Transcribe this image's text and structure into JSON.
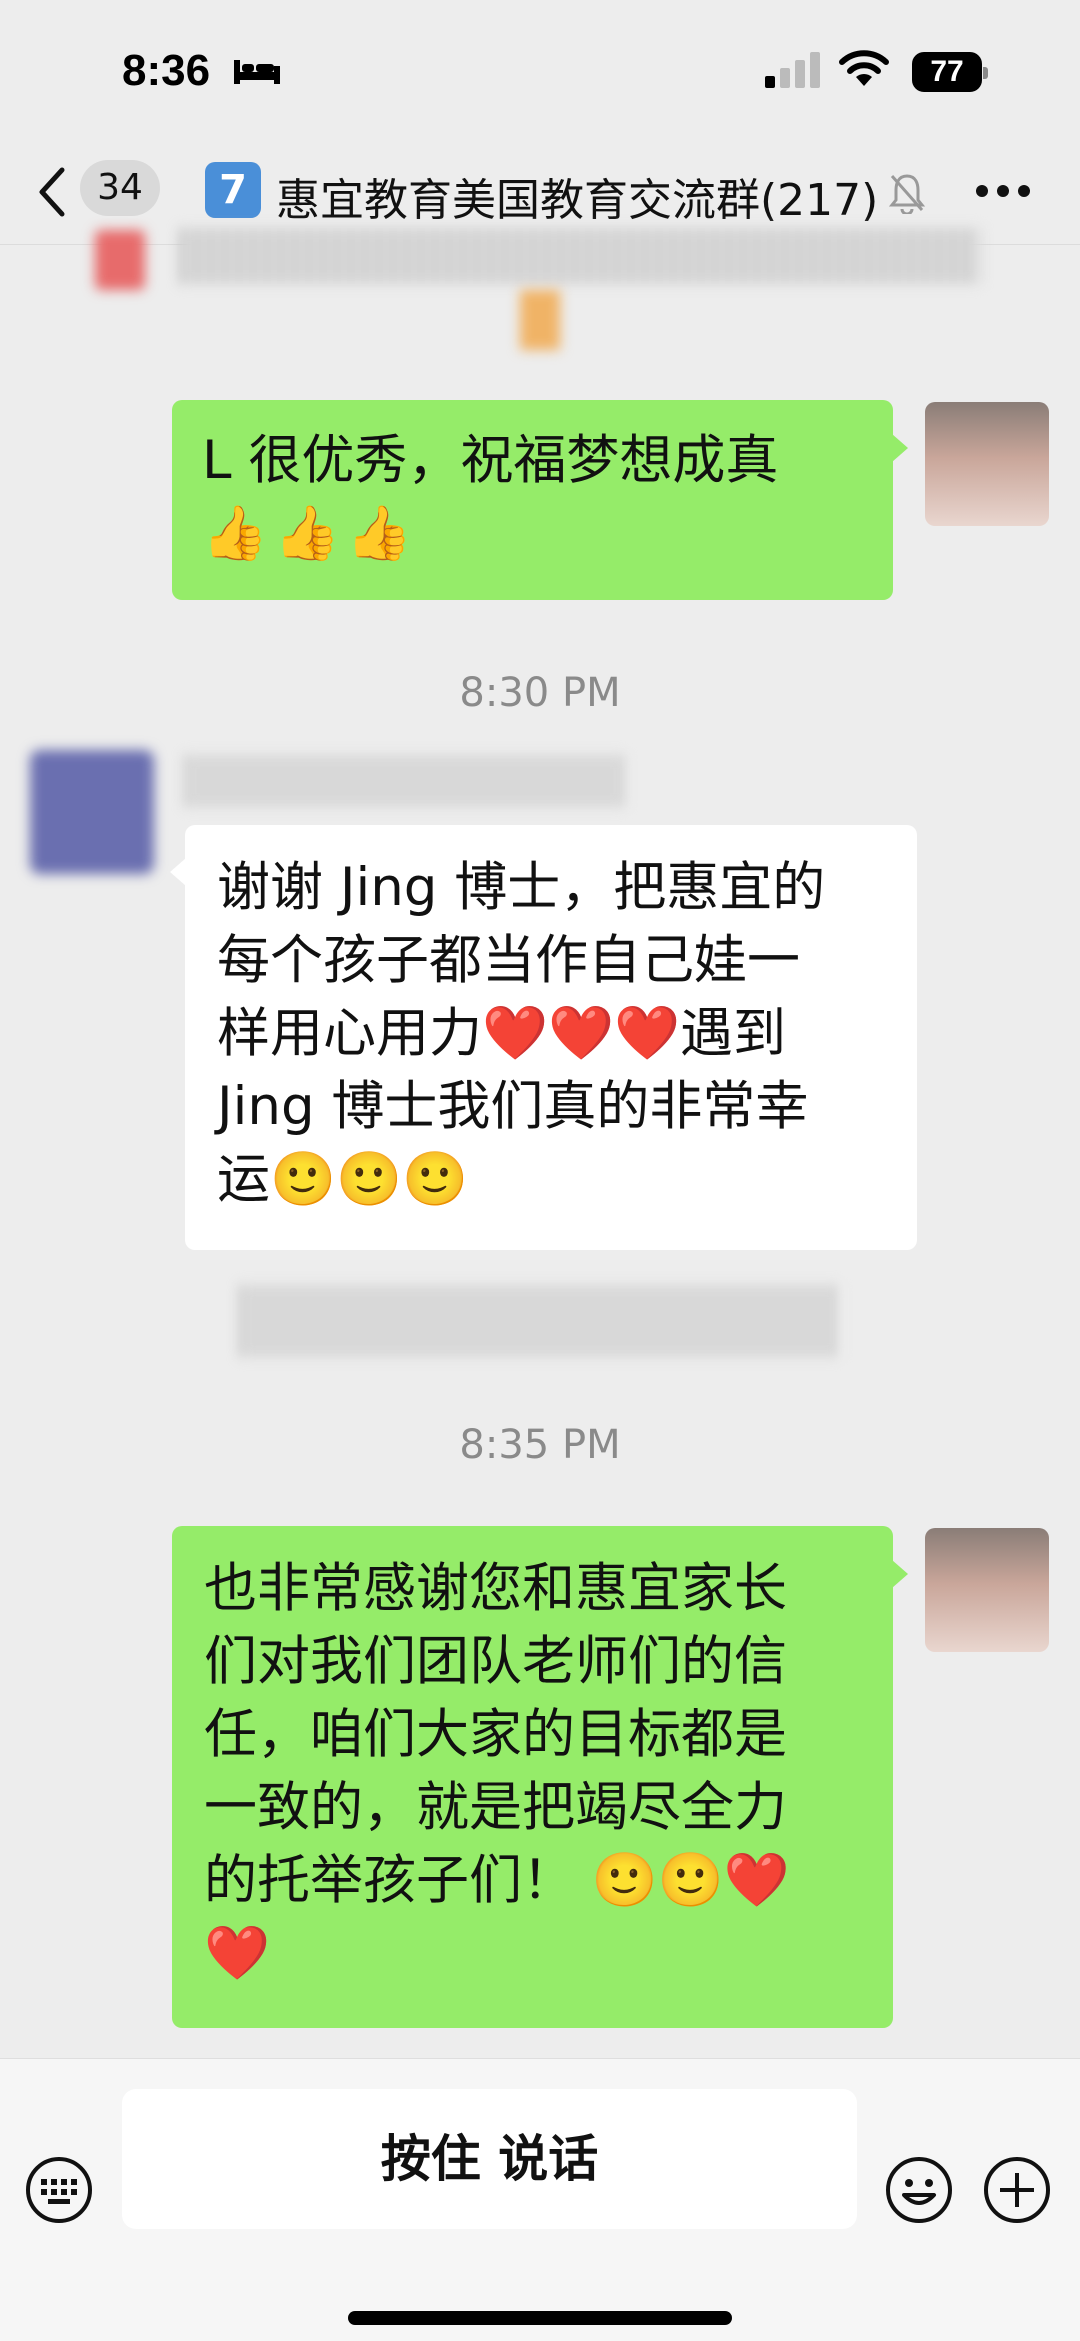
{
  "status": {
    "time": "8:36",
    "battery": "77"
  },
  "nav": {
    "back_count": "34",
    "group_number": "7",
    "title": "惠宜教育美国教育交流群(217)",
    "mute_icon": "bell-slash-icon",
    "more_icon": "ellipsis-icon"
  },
  "messages": [
    {
      "side": "right",
      "text": "L 很优秀，祝福梦想成真",
      "emoji": "👍👍👍"
    },
    {
      "timestamp": "8:30 PM"
    },
    {
      "side": "left",
      "lines": [
        "谢谢 Jing 博士，把惠宜的",
        "每个孩子都当作自己娃一",
        "样用心用力❤️❤️❤️遇到",
        "Jing 博士我们真的非常幸",
        "运🙂🙂🙂"
      ]
    },
    {
      "timestamp": "8:35 PM"
    },
    {
      "side": "right",
      "lines": [
        "也非常感谢您和惠宜家长",
        "们对我们团队老师们的信",
        "任，咱们大家的目标都是",
        "一致的，就是把竭尽全力",
        "的托举孩子们！ 🙂🙂❤️",
        "❤️"
      ]
    }
  ],
  "bottom": {
    "voice_label": "按住 说话"
  },
  "colors": {
    "bubble_green": "#95ec69",
    "background": "#ededed"
  }
}
